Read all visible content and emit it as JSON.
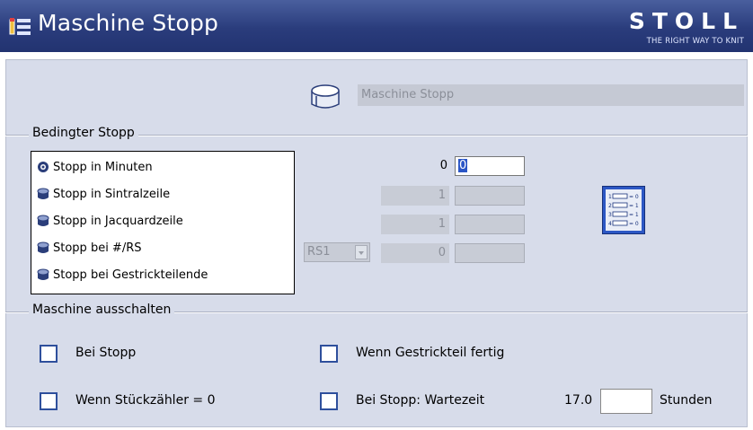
{
  "window": {
    "title": "Maschine Stopp",
    "logo_main": "STOLL",
    "logo_sub": "THE RIGHT WAY TO KNIT"
  },
  "name_field": {
    "value": "Maschine Stopp"
  },
  "bedingter_stopp": {
    "title": "Bedingter Stopp",
    "options": [
      {
        "label": "Stopp in Minuten",
        "selected": true
      },
      {
        "label": "Stopp in Sintralzeile",
        "selected": false
      },
      {
        "label": "Stopp in Jacquardzeile",
        "selected": false
      },
      {
        "label": "Stopp bei #/RS",
        "selected": false
      },
      {
        "label": "Stopp bei Gestrickteilende",
        "selected": false
      }
    ],
    "row1": {
      "current": "0",
      "input": "0"
    },
    "row2": {
      "current": "1",
      "input": ""
    },
    "row3": {
      "current": "1",
      "input": ""
    },
    "row4": {
      "select": "RS1",
      "current": "0",
      "input": ""
    },
    "switch_icon": "dip-switch-icon"
  },
  "ausschalten": {
    "title": "Maschine ausschalten",
    "bei_stopp": "Bei Stopp",
    "wenn_gestrickteil": "Wenn Gestrickteil fertig",
    "wenn_stueckzaehler": "Wenn Stückzähler = 0",
    "bei_stopp_wartezeit": "Bei Stopp: Wartezeit",
    "wartezeit_value": "17.0",
    "unit": "Stunden"
  }
}
